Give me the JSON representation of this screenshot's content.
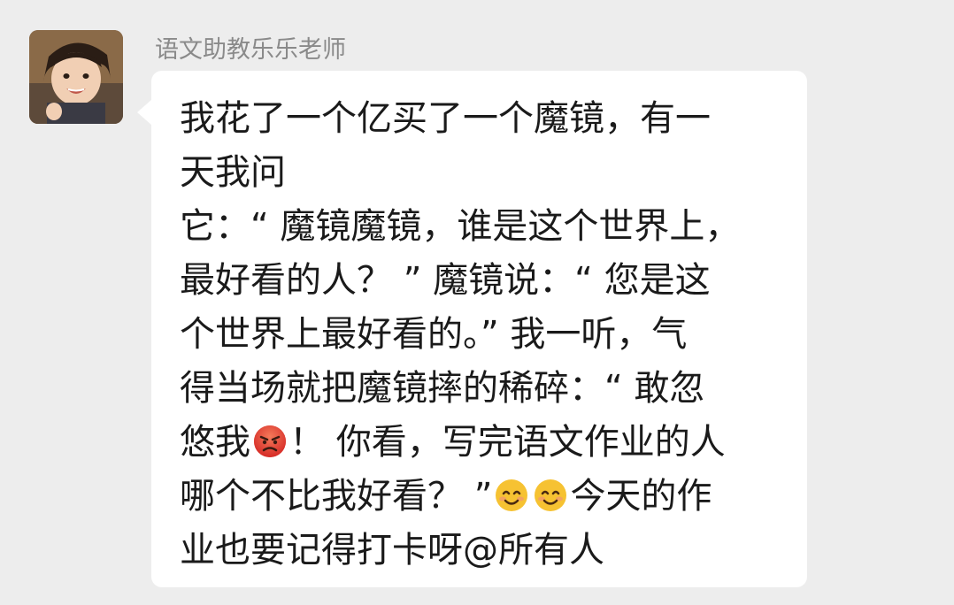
{
  "chat": {
    "sender_name": "语文助教乐乐老师",
    "avatar_icon": "child-avatar",
    "message": {
      "line1": "我花了一个亿买了一个魔镜，有一",
      "line2": "天我问",
      "line3": "它：“ 魔镜魔镜，谁是这个世界上，",
      "line4": "最好看的人？ ” 魔镜说：“ 您是这",
      "line5": "个世界上最好看的。” 我一听，气",
      "line6": "得当场就把魔镜摔的稀碎：“ 敢忽",
      "line7_a": "悠我",
      "line7_emoji": "angry-face",
      "line7_b": "！ 你看，写完语文作业的人",
      "line8_a": "哪个不比我好看？ ”",
      "line8_emoji1": "smiling-face",
      "line8_emoji2": "smiling-face",
      "line8_b": "今天的作",
      "line9": "业也要记得打卡呀@所有人"
    }
  },
  "colors": {
    "background": "#ededed",
    "bubble": "#ffffff",
    "name_text": "#8a8a8a",
    "message_text": "#1a1a1a"
  }
}
